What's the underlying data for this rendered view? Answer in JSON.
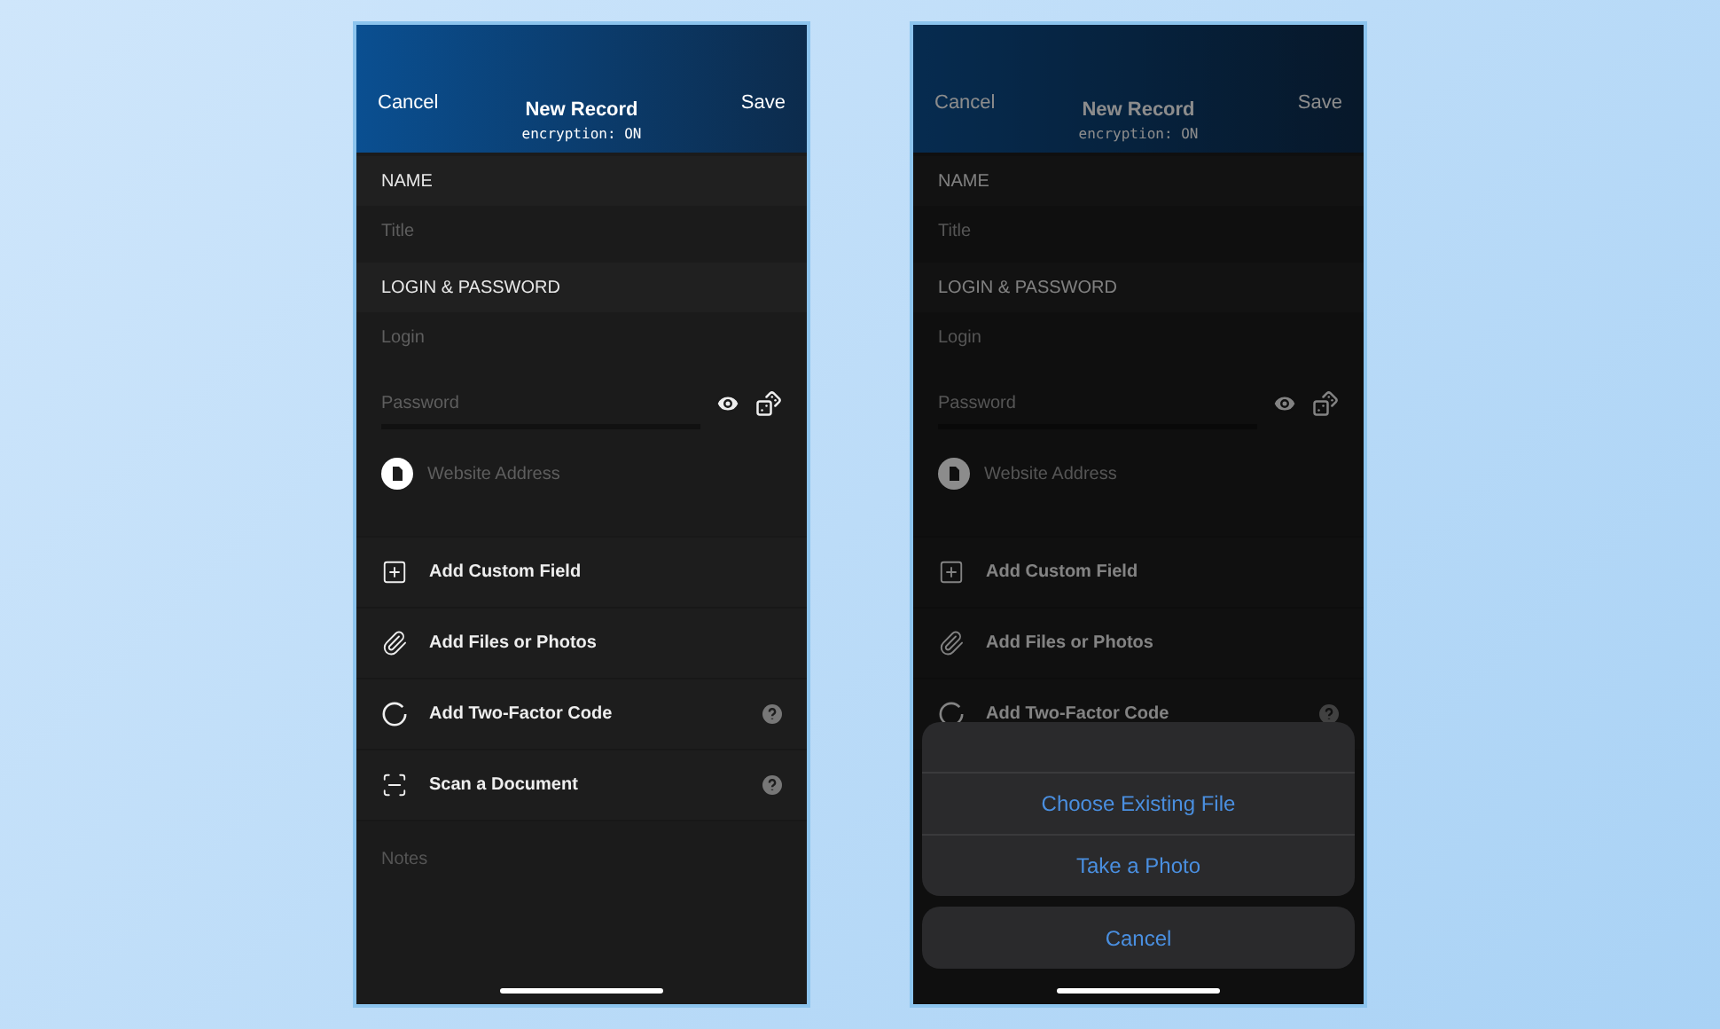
{
  "screens": [
    {
      "dimmed": false,
      "header": {
        "cancel": "Cancel",
        "title": "New Record",
        "subtitle": "encryption: ON",
        "save": "Save"
      },
      "sections": [
        {
          "label": "NAME",
          "fields": [
            {
              "kind": "text",
              "placeholder": "Title"
            }
          ]
        },
        {
          "label": "LOGIN & PASSWORD",
          "fields": [
            {
              "kind": "text",
              "placeholder": "Login"
            },
            {
              "kind": "password",
              "placeholder": "Password"
            },
            {
              "kind": "website",
              "placeholder": "Website Address"
            }
          ]
        }
      ],
      "actions": [
        {
          "kind": "custom_field",
          "label": "Add Custom Field",
          "help": false
        },
        {
          "kind": "files",
          "label": "Add Files or Photos",
          "help": false
        },
        {
          "kind": "two_factor",
          "label": "Add Two-Factor Code",
          "help": true
        },
        {
          "kind": "scan",
          "label": "Scan a Document",
          "help": true
        }
      ],
      "notes": {
        "placeholder": "Notes"
      }
    },
    {
      "dimmed": true,
      "header": {
        "cancel": "Cancel",
        "title": "New Record",
        "subtitle": "encryption: ON",
        "save": "Save"
      },
      "sections": [
        {
          "label": "NAME",
          "fields": [
            {
              "kind": "text",
              "placeholder": "Title"
            }
          ]
        },
        {
          "label": "LOGIN & PASSWORD",
          "fields": [
            {
              "kind": "text",
              "placeholder": "Login"
            },
            {
              "kind": "password",
              "placeholder": "Password"
            },
            {
              "kind": "website",
              "placeholder": "Website Address"
            }
          ]
        }
      ],
      "actions": [
        {
          "kind": "custom_field",
          "label": "Add Custom Field",
          "help": false
        },
        {
          "kind": "files",
          "label": "Add Files or Photos",
          "help": false
        },
        {
          "kind": "two_factor",
          "label": "Add Two-Factor Code",
          "help": true
        }
      ],
      "action_sheet": {
        "options": [
          "Choose Existing File",
          "Take a Photo"
        ],
        "cancel": "Cancel"
      }
    }
  ]
}
